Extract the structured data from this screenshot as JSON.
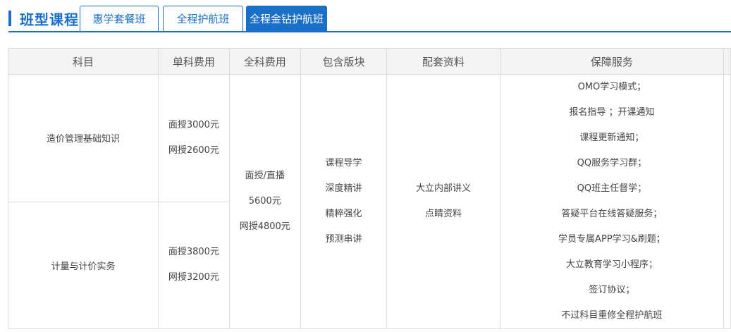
{
  "header": {
    "title": "班型课程",
    "tabs": [
      {
        "label": "惠学套餐班",
        "active": false
      },
      {
        "label": "全程护航班",
        "active": false
      },
      {
        "label": "全程金钻护航班",
        "active": true
      }
    ]
  },
  "table": {
    "columns": [
      "科目",
      "单科费用",
      "全科费用",
      "包含版块",
      "配套资料",
      "保障服务"
    ],
    "rows": [
      {
        "subject": "造价管理基础知识",
        "fees": [
          "面授3000元",
          "网授2600元"
        ]
      },
      {
        "subject": "计量与计价实务",
        "fees": [
          "面授3800元",
          "网授3200元"
        ]
      }
    ],
    "total_fee": [
      "面授/直播",
      "5600元",
      "网授4800元"
    ],
    "modules": [
      "课程导学",
      "深度精讲",
      "精粹强化",
      "预测串讲"
    ],
    "materials": [
      "大立内部讲义",
      "点睛资料"
    ],
    "services": [
      "OMO学习模式；",
      "报名指导 ；开课通知",
      "课程更新通知；",
      "QQ服务学习群；",
      "QQ班主任督学；",
      "答疑平台在线答疑服务；",
      "学员专属APP学习&刷题；",
      "大立教育学习小程序；",
      "签订协议；",
      "不过科目重修全程护航班"
    ]
  },
  "colors": {
    "accent": "#1a6fc9",
    "header_bg": "#f3f3f3",
    "border": "#dcdcdc"
  }
}
